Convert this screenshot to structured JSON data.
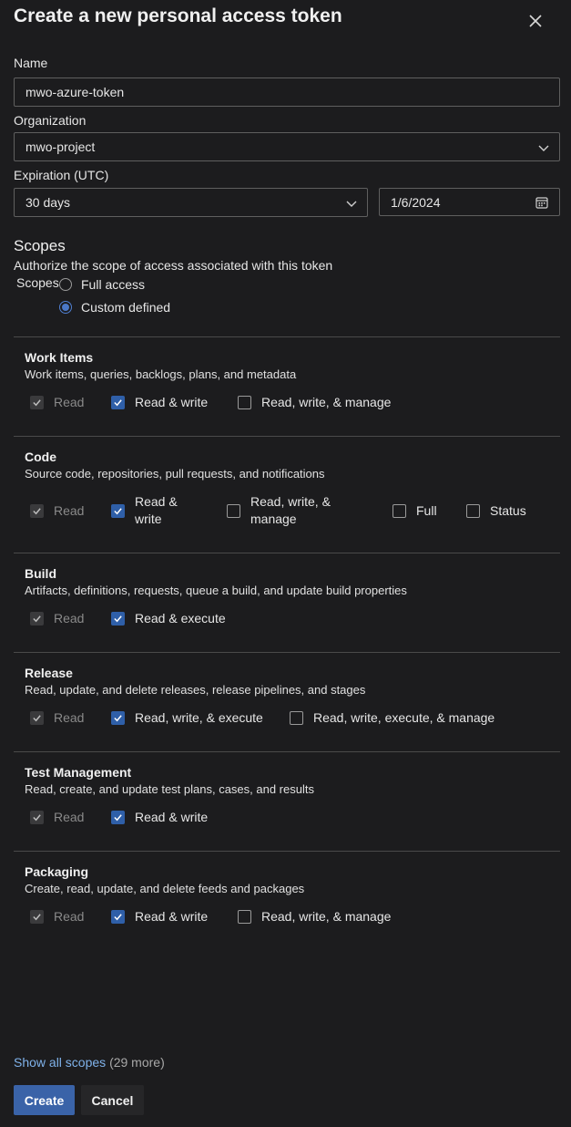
{
  "dialog": {
    "title": "Create a new personal access token",
    "close_icon": "close-icon"
  },
  "form": {
    "name_label": "Name",
    "name_value": "mwo-azure-token",
    "org_label": "Organization",
    "org_value": "mwo-project",
    "expiration_label": "Expiration (UTC)",
    "expiration_value": "30 days",
    "date_value": "1/6/2024"
  },
  "scopes": {
    "heading": "Scopes",
    "description": "Authorize the scope of access associated with this token",
    "radio_label": "Scopes",
    "full_access": "Full access",
    "custom_defined": "Custom defined",
    "selected": "custom_defined"
  },
  "sections": {
    "work_items": {
      "title": "Work Items",
      "desc": "Work items, queries, backlogs, plans, and metadata",
      "opts": [
        "Read",
        "Read & write",
        "Read, write, & manage"
      ]
    },
    "code": {
      "title": "Code",
      "desc": "Source code, repositories, pull requests, and notifications",
      "opts": [
        "Read",
        "Read &",
        "write",
        "Read, write, &",
        "manage",
        "Full",
        "Status"
      ]
    },
    "build": {
      "title": "Build",
      "desc": "Artifacts, definitions, requests, queue a build, and update build properties",
      "opts": [
        "Read",
        "Read & execute"
      ]
    },
    "release": {
      "title": "Release",
      "desc": "Read, update, and delete releases, release pipelines, and stages",
      "opts": [
        "Read",
        "Read, write, & execute",
        "Read, write, execute, & manage"
      ]
    },
    "test": {
      "title": "Test Management",
      "desc": "Read, create, and update test plans, cases, and results",
      "opts": [
        "Read",
        "Read & write"
      ]
    },
    "packaging": {
      "title": "Packaging",
      "desc": "Create, read, update, and delete feeds and packages",
      "opts": [
        "Read",
        "Read & write",
        "Read, write, & manage"
      ]
    }
  },
  "footer": {
    "show_all": "Show all scopes",
    "more": "(29 more)",
    "create": "Create",
    "cancel": "Cancel"
  },
  "colors": {
    "background": "#1c1c1e",
    "accent": "#3a63a8",
    "link": "#7fb2ea"
  }
}
